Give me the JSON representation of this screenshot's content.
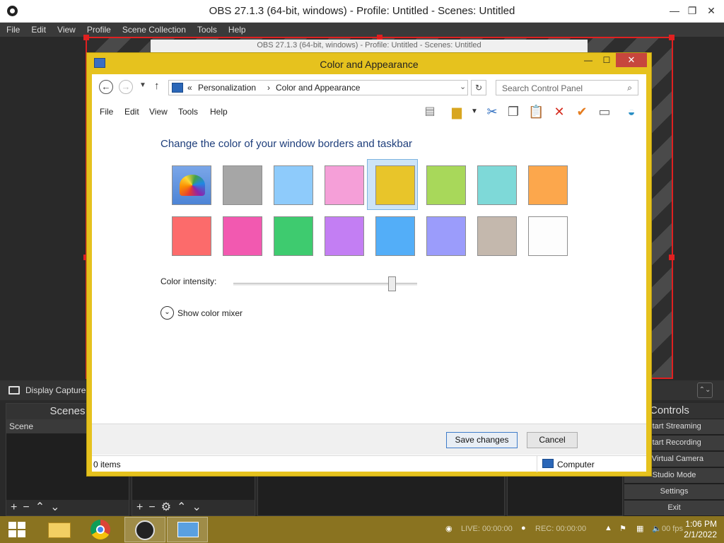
{
  "obs": {
    "title": "OBS 27.1.3 (64-bit, windows) - Profile: Untitled - Scenes: Untitled",
    "menu": [
      "File",
      "Edit",
      "View",
      "Profile",
      "Scene Collection",
      "Tools",
      "Help"
    ],
    "preview_title": "OBS 27.1.3 (64-bit, windows) - Profile: Untitled - Scenes: Untitled",
    "source_name": "Display Capture",
    "scenes_title": "Scenes",
    "scene_item": "Scene",
    "controls_title": "Controls",
    "controls": [
      "Start Streaming",
      "Start Recording",
      "rt Virtual Camera",
      "Studio Mode",
      "Settings",
      "Exit"
    ],
    "status_live": "LIVE: 00:00:00",
    "status_rec": "REC: 00:00:00",
    "status_fps": "00 fps"
  },
  "dialog": {
    "title": "Color and Appearance",
    "breadcrumb": [
      "Personalization",
      "Color and Appearance"
    ],
    "search_placeholder": "Search Control Panel",
    "menu": [
      "File",
      "Edit",
      "View",
      "Tools",
      "Help"
    ],
    "heading": "Change the color of your window borders and taskbar",
    "colors_row1": [
      "#multicolor",
      "#a6a6a6",
      "#8ecbfb",
      "#f59fd8",
      "#e8c52a",
      "#a8d85a",
      "#7ed9d8",
      "#fca74c"
    ],
    "colors_row2": [
      "#fc6b6b",
      "#f259b0",
      "#3ecb6f",
      "#c37ef3",
      "#53aef8",
      "#9b9cfb",
      "#c4b8ad",
      "#fdfdfd"
    ],
    "selected_index": 4,
    "intensity_label": "Color intensity:",
    "intensity_value": 0.86,
    "mixer_label": "Show color mixer",
    "save_label": "Save changes",
    "cancel_label": "Cancel",
    "status_items": "0 items",
    "status_computer": "Computer"
  },
  "taskbar": {
    "time": "1:06 PM",
    "date": "2/1/2022"
  }
}
